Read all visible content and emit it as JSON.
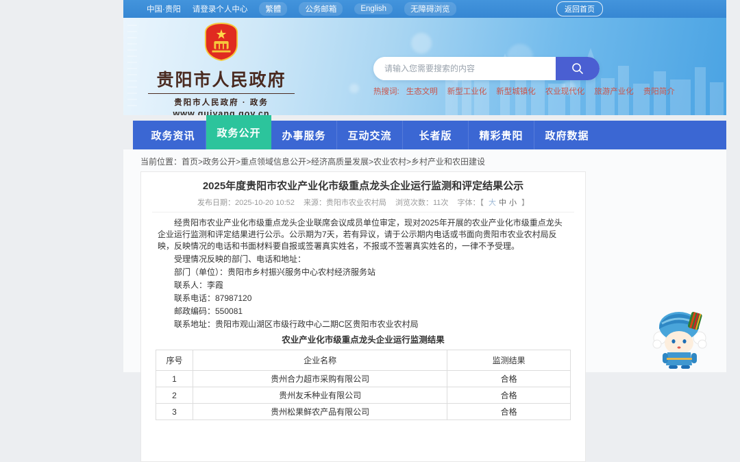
{
  "topbar": {
    "items": [
      "中国·贵阳",
      "请登录个人中心",
      "繁體",
      "公务邮箱",
      "English",
      "无障碍浏览"
    ],
    "back_home": "返回首页"
  },
  "logo": {
    "title": "贵阳市人民政府",
    "subtitle": "贵阳市人民政府 · 政务",
    "url": "www.guiyang.gov.cn"
  },
  "search": {
    "placeholder": "请输入您需要搜索的内容",
    "hot_label": "热搜词:",
    "hot_words": [
      "生态文明",
      "新型工业化",
      "新型城镇化",
      "农业现代化",
      "旅游产业化",
      "贵阳简介"
    ]
  },
  "nav": {
    "tabs": [
      {
        "label": "政务资讯",
        "active": false
      },
      {
        "label": "政务公开",
        "active": true
      },
      {
        "label": "办事服务",
        "active": false
      },
      {
        "label": "互动交流",
        "active": false
      },
      {
        "label": "长者版",
        "active": false
      },
      {
        "label": "精彩贵阳",
        "active": false
      },
      {
        "label": "政府数据",
        "active": false
      }
    ]
  },
  "breadcrumb": {
    "label": "当前位置：",
    "trail": "首页>政务公开>重点领域信息公开>经济高质量发展>农业农村>乡村产业和农田建设"
  },
  "article": {
    "title": "2025年度贵阳市农业产业化市级重点龙头企业运行监测和评定结果公示",
    "meta": {
      "published": "发布日期：2025-10-20 10:52",
      "source": "来源：贵阳市农业农村局",
      "views": "浏览次数：11次",
      "font_prefix": "字体：【",
      "size_large": "大",
      "size_medium": "中",
      "size_small": "小",
      "font_suffix": "】"
    },
    "paragraphs": [
      "经贵阳市农业产业化市级重点龙头企业联席会议成员单位审定，现对2025年开展的农业产业化市级重点龙头企业运行监测和评定结果进行公示。公示期为7天，若有异议，请于公示期内电话或书面向贵阳市农业农村局反映，反映情况的电话和书面材料要自报或签署真实姓名，不报或不签署真实姓名的，一律不予受理。",
      "受理情况反映的部门、电话和地址：",
      "部门（单位）：贵阳市乡村振兴服务中心农村经济服务站",
      "联系人：李霞",
      "联系电话：87987120",
      "邮政编码：550081",
      "联系地址：贵阳市观山湖区市级行政中心二期C区贵阳市农业农村局"
    ],
    "table": {
      "title": "农业产业化市级重点龙头企业运行监测结果",
      "headers": [
        "序号",
        "企业名称",
        "监测结果"
      ],
      "rows": [
        {
          "no": "1",
          "company": "贵州合力超市采购有限公司",
          "result": "合格"
        },
        {
          "no": "2",
          "company": "贵州友禾种业有限公司",
          "result": "合格"
        },
        {
          "no": "3",
          "company": "贵州松果鲜农产品有限公司",
          "result": "合格"
        }
      ]
    }
  },
  "colors": {
    "topbar_blue": "#3d8ed8",
    "nav_blue": "#3b67d3",
    "active_tab_green": "#2cc49c",
    "search_button_indigo": "#4a5fd2",
    "hot_word_red": "#c9544a",
    "logo_brown": "#4a2a20"
  }
}
